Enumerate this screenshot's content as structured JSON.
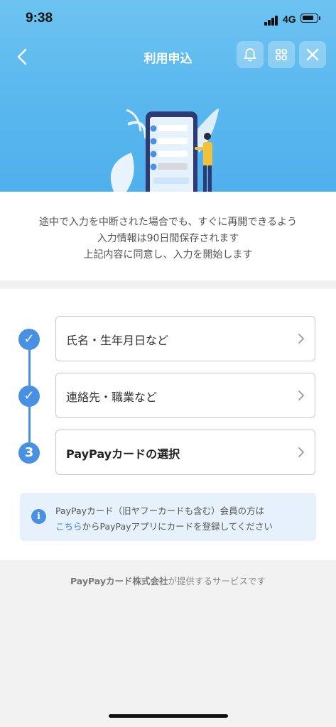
{
  "status": {
    "time": "9:38",
    "network": "4G"
  },
  "header": {
    "title": "利用申込"
  },
  "intro": {
    "lines": [
      "途中で入力を中断された場合でも、すぐに再開できるよう",
      "入力情報は90日間保存されます",
      "上記内容に同意し、入力を開始します"
    ]
  },
  "steps": [
    {
      "marker": "✓",
      "label": "氏名・生年月日など",
      "state": "done"
    },
    {
      "marker": "✓",
      "label": "連絡先・職業など",
      "state": "done"
    },
    {
      "marker": "3",
      "label": "PayPayカードの選択",
      "state": "current"
    }
  ],
  "notice": {
    "line1": "PayPayカード（旧ヤフーカードも含む）会員の方は",
    "link": "こちら",
    "line2_rest": "からPayPayアプリにカードを登録してください"
  },
  "footer": {
    "company": "PayPayカード株式会社",
    "suffix": "が提供するサービスです"
  },
  "colors": {
    "accent": "#4a90e2",
    "hero": "#59b7ee",
    "link": "#3f86d9"
  }
}
